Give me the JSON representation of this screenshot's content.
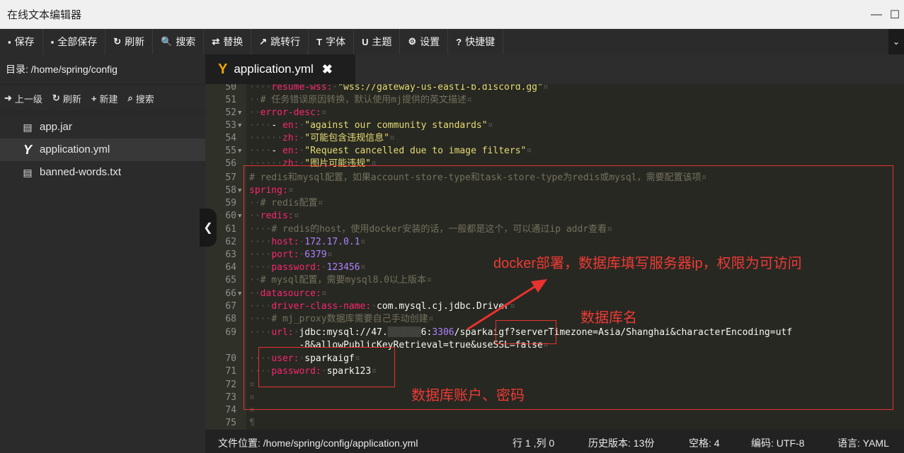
{
  "window": {
    "title": "在线文本编辑器",
    "controls": [
      "—",
      "☐"
    ]
  },
  "toolbar": {
    "items": [
      {
        "icon": "save-icon",
        "glyph": "▪",
        "label": "保存"
      },
      {
        "icon": "save-all-icon",
        "glyph": "▪",
        "label": "全部保存"
      },
      {
        "icon": "refresh-icon",
        "glyph": "↻",
        "label": "刷新"
      },
      {
        "icon": "search-icon",
        "glyph": "🔍",
        "label": "搜索"
      },
      {
        "icon": "replace-icon",
        "glyph": "⇄",
        "label": "替换"
      },
      {
        "icon": "goto-line-icon",
        "glyph": "↗",
        "label": "跳转行"
      },
      {
        "icon": "font-icon",
        "glyph": "T",
        "label": "字体"
      },
      {
        "icon": "theme-icon",
        "glyph": "U",
        "label": "主题"
      },
      {
        "icon": "settings-icon",
        "glyph": "⚙",
        "label": "设置"
      },
      {
        "icon": "help-icon",
        "glyph": "?",
        "label": "快捷键"
      }
    ]
  },
  "sidebar": {
    "directory": "目录: /home/spring/config",
    "actions": [
      {
        "icon": "up-level-icon",
        "glyph": "➜",
        "label": "上一级"
      },
      {
        "icon": "refresh-icon",
        "glyph": "↻",
        "label": "刷新"
      },
      {
        "icon": "plus-icon",
        "glyph": "+",
        "label": "新建"
      },
      {
        "icon": "search-icon",
        "glyph": "⌕",
        "label": "搜索"
      }
    ],
    "files": [
      {
        "name": "app.jar",
        "icon": "file-icon",
        "active": false
      },
      {
        "name": "application.yml",
        "icon": "yaml-icon",
        "active": true
      },
      {
        "name": "banned-words.txt",
        "icon": "file-icon",
        "active": false
      }
    ]
  },
  "tab": {
    "title": "application.yml",
    "close": "✖"
  },
  "editor": {
    "lines": [
      {
        "n": "50",
        "text": "    resume-wss: \"wss://gateway-us-east1-b.discord.gg\""
      },
      {
        "n": "51",
        "text": "  # 任务错误原因转换，默认使用mj提供的英文描述"
      },
      {
        "n": "52",
        "text": "  error-desc:"
      },
      {
        "n": "53",
        "text": "    - en: \"against our community standards\""
      },
      {
        "n": "54",
        "text": "      zh: \"可能包含违规信息\""
      },
      {
        "n": "55",
        "text": "    - en: \"Request cancelled due to image filters\""
      },
      {
        "n": "56",
        "text": "      zh: \"图片可能违规\""
      },
      {
        "n": "57",
        "text": "# redis和mysql配置，如果account-store-type和task-store-type为redis或mysql，需要配置该项"
      },
      {
        "n": "58",
        "text": "spring:"
      },
      {
        "n": "59",
        "text": "  # redis配置"
      },
      {
        "n": "60",
        "text": "  redis:"
      },
      {
        "n": "61",
        "text": "    # redis的host，使用docker安装的话，一般都是这个，可以通过ip addr查看"
      },
      {
        "n": "62",
        "text": "    host: 172.17.0.1"
      },
      {
        "n": "63",
        "text": "    port: 6379"
      },
      {
        "n": "64",
        "text": "    password: 123456"
      },
      {
        "n": "65",
        "text": "  # mysql配置，需要mysql8.0以上版本"
      },
      {
        "n": "66",
        "text": "  datasource:"
      },
      {
        "n": "67",
        "text": "    driver-class-name: com.mysql.cj.jdbc.Driver"
      },
      {
        "n": "68",
        "text": "    # mj_proxy数据库需要自己手动创建"
      },
      {
        "n": "69",
        "text": "    url: jdbc:mysql://47.        6:3306/sparkaigf?serverTimezone=Asia/Shanghai&characterEncoding=utf"
      },
      {
        "n": "",
        "text": "-8&allowPublicKeyRetrieval=true&useSSL=false"
      },
      {
        "n": "70",
        "text": "    user: sparkaigf"
      },
      {
        "n": "71",
        "text": "    password: spark123"
      },
      {
        "n": "72",
        "text": ""
      },
      {
        "n": "73",
        "text": ""
      },
      {
        "n": "74",
        "text": ""
      },
      {
        "n": "75",
        "text": ""
      }
    ]
  },
  "annotations": {
    "docker_note": "docker部署，数据库填写服务器ip，权限为可访问",
    "db_name_note": "数据库名",
    "account_note": "数据库账户、密码",
    "color": "#e8322f"
  },
  "status": {
    "file_location": "文件位置: /home/spring/config/application.yml",
    "cursor": "行 1 ,列 0",
    "history": "历史版本: 13份",
    "indent": "空格: 4",
    "encoding": "编码: UTF-8",
    "language": "语言: YAML"
  }
}
